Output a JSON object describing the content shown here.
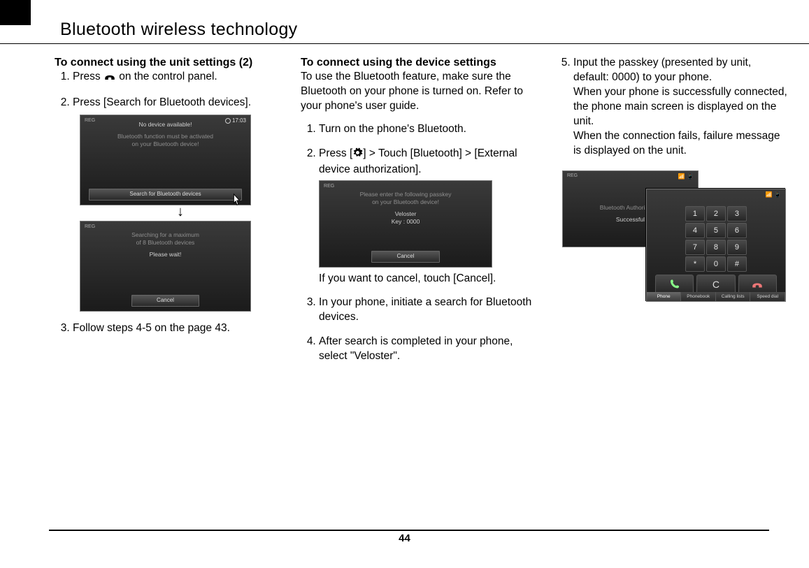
{
  "page": {
    "title": "Bluetooth wireless technology",
    "number": "44"
  },
  "col1": {
    "heading": "To connect using the unit settings (2)",
    "steps": [
      {
        "pre": "Press ",
        "post": " on the control panel."
      },
      {
        "text": "Press [Search for Bluetooth devices]."
      },
      {
        "text": "Follow steps 4-5 on the page 43."
      }
    ],
    "screen_a": {
      "reg": "REG",
      "clock": "17:03",
      "line1": "No device available!",
      "line2a": "Bluetooth function must be activated",
      "line2b": "on your Bluetooth device!",
      "button": "Search for Bluetooth devices"
    },
    "screen_b": {
      "reg": "REG",
      "line1": "Searching for a maximum",
      "line2": "of 8 Bluetooth devices",
      "line3": "Please wait!",
      "button": "Cancel"
    }
  },
  "col2": {
    "heading": "To connect using the device settings",
    "intro": "To use the Bluetooth feature, make sure the Bluetooth on your phone is turned on. Refer to your phone's user guide.",
    "steps": [
      {
        "text": "Turn on the phone's Bluetooth."
      },
      {
        "pre": "Press [",
        "mid": "] > Touch [Bluetooth] > [External device authorization]."
      },
      {
        "text": "In your phone, initiate a search for Bluetooth devices."
      },
      {
        "text": "After search is completed in your phone, select \"Veloster\"."
      }
    ],
    "screen": {
      "reg": "REG",
      "line1": "Please enter the following passkey",
      "line2": "on your Bluetooth device!",
      "line3": "Veloster",
      "line4": "Key : 0000",
      "button": "Cancel"
    },
    "after_screen": "If you want to cancel, touch [Cancel]."
  },
  "col3": {
    "start": 5,
    "steps": [
      {
        "text": "Input the passkey (presented by unit, default: 0000) to your phone.\nWhen your phone is successfully connected, the phone main screen is displayed on the unit.\nWhen the connection fails, failure message is displayed on the unit."
      }
    ],
    "screen_a": {
      "reg": "REG",
      "line1": "Bluetooth Authorization",
      "line2": "Successful"
    },
    "screen_b": {
      "keys": [
        "1",
        "2",
        "3",
        "4",
        "5",
        "6",
        "7",
        "8",
        "9",
        "*",
        "0",
        "#"
      ],
      "tabs": [
        "Phone",
        "Phonebook",
        "Calling lists",
        "Speed dial"
      ],
      "c_label": "C"
    }
  }
}
